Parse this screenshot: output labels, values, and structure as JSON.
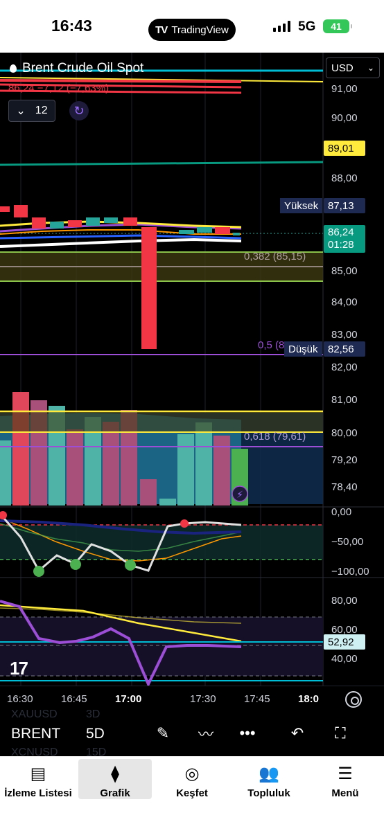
{
  "status_bar": {
    "time": "16:43",
    "app_pill": "TradingView",
    "network": "5G",
    "battery": "41"
  },
  "chart": {
    "symbol_title": "Brent Crude Oil Spot",
    "last_change": "86,24 −7,12 (−7,63%)",
    "collapse_count": "12",
    "currency": "USD",
    "price_axis": [
      "91,00",
      "90,00",
      "88,00",
      "85,00",
      "84,00",
      "83,00",
      "82,00",
      "81,00",
      "80,00",
      "79,20",
      "78,40"
    ],
    "tags": {
      "yellow_level": "89,01",
      "high_label": "Yüksek",
      "high_value": "87,13",
      "last_price": "86,24",
      "countdown": "01:28",
      "low_label": "Düşük",
      "low_value": "82,56"
    },
    "fib": {
      "f382": "0,382 (85,15)",
      "f5": "0,5 (82,76)",
      "f618": "0,618 (79,61)"
    },
    "osc1_axis": [
      "0,00",
      "−50,00",
      "−100,00"
    ],
    "osc2_axis": [
      "80,00",
      "60,00",
      "40,00"
    ],
    "osc2_value": "52,92",
    "time_axis": [
      "16:30",
      "16:45",
      "17:00",
      "17:30",
      "17:45",
      "18:0"
    ],
    "colors": {
      "up": "#26a69a",
      "down": "#f23645",
      "fib_yellow": "#ffeb3b",
      "teal_line": "#089981",
      "cyan_line": "#00bcd4",
      "purple": "#9c4fd6"
    }
  },
  "toolbar": {
    "symbol": "BRENT",
    "timeframe": "5D",
    "ghost_symbols": [
      "XAUUSD",
      "XCNUSD"
    ],
    "ghost_timeframes": [
      "3D",
      "15D"
    ]
  },
  "tabs": [
    {
      "label": "İzleme Listesi",
      "icon": "document-icon"
    },
    {
      "label": "Grafik",
      "icon": "candles-icon"
    },
    {
      "label": "Keşfet",
      "icon": "compass-icon"
    },
    {
      "label": "Topluluk",
      "icon": "people-icon"
    },
    {
      "label": "Menü",
      "icon": "hamburger-icon"
    }
  ]
}
